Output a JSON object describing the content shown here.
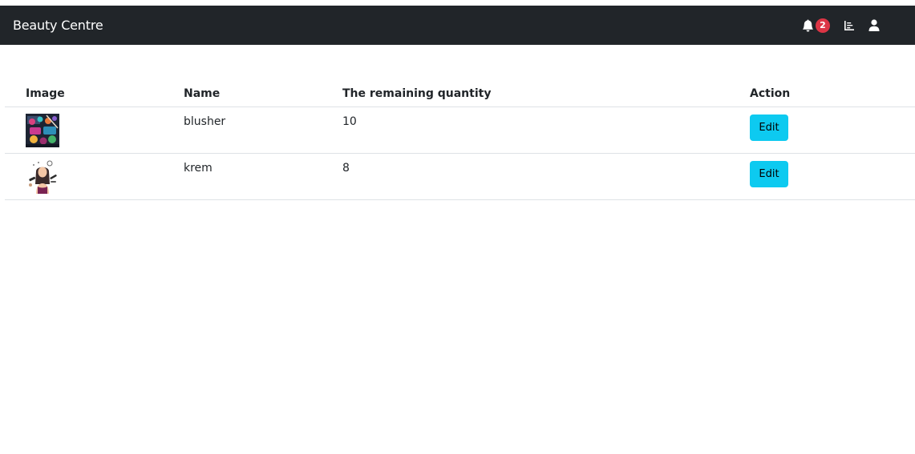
{
  "navbar": {
    "brand": "Beauty Centre",
    "notification_count": "2",
    "icons": [
      "bell-icon",
      "chart-icon",
      "user-icon"
    ]
  },
  "table": {
    "headers": [
      "Image",
      "Name",
      "The remaining quantity",
      "Action"
    ],
    "rows": [
      {
        "name": "blusher",
        "quantity": "10",
        "action": "Edit",
        "image": "makeup-palette-thumbnail"
      },
      {
        "name": "krem",
        "quantity": "8",
        "action": "Edit",
        "image": "woman-beauty-illustration-thumbnail"
      }
    ]
  },
  "colors": {
    "navbar_bg": "#212529",
    "badge": "#dc3545",
    "edit_button": "#0dcaf0"
  }
}
